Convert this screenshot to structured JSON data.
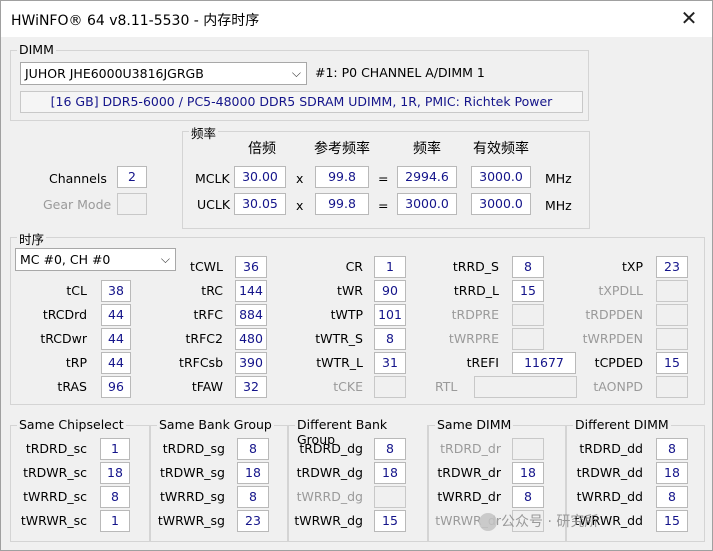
{
  "window": {
    "title": "HWiNFO® 64 v8.11-5530 - 内存时序"
  },
  "dimm": {
    "group_label": "DIMM",
    "module_select": "JUHOR JHE6000U3816JGRGB",
    "slot_text": "#1: P0 CHANNEL A/DIMM 1",
    "info": "[16 GB] DDR5-6000 / PC5-48000 DDR5 SDRAM UDIMM, 1R, PMIC: Richtek Power"
  },
  "freq": {
    "group_label": "频率",
    "headers": {
      "multiplier": "倍频",
      "ref": "参考频率",
      "freq": "频率",
      "eff": "有效频率"
    },
    "mclk": {
      "label": "MCLK",
      "multiplier": "30.00",
      "ref": "99.8",
      "freq": "2994.6",
      "eff": "3000.0"
    },
    "uclk": {
      "label": "UCLK",
      "multiplier": "30.05",
      "ref": "99.8",
      "freq": "3000.0",
      "eff": "3000.0"
    },
    "times": "x",
    "equals": "=",
    "unit": "MHz"
  },
  "channels": {
    "label": "Channels",
    "value": "2",
    "gear_label": "Gear Mode",
    "gear_value": ""
  },
  "timings": {
    "group_label": "时序",
    "select": "MC #0, CH #0",
    "tCL": "38",
    "tRCDrd": "44",
    "tRCDwr": "44",
    "tRP": "44",
    "tRAS": "96",
    "tCWL": "36",
    "tRC": "144",
    "tRFC": "884",
    "tRFC2": "480",
    "tRFCsb": "390",
    "tFAW": "32",
    "CR": "1",
    "tWR": "90",
    "tWTP": "101",
    "tWTR_S": "8",
    "tWTR_L": "31",
    "tCKE": "",
    "tRRD_S": "8",
    "tRRD_L": "15",
    "tRDPRE": "",
    "tWRPRE": "",
    "tREFI": "11677",
    "RTL": "",
    "tXP": "23",
    "tXPDLL": "",
    "tRDPDEN": "",
    "tWRPDEN": "",
    "tCPDED": "15",
    "tAONPD": ""
  },
  "bottom": {
    "same_chipselect": {
      "label": "Same Chipselect",
      "rows": [
        {
          "name": "tRDRD_sc",
          "value": "1"
        },
        {
          "name": "tRDWR_sc",
          "value": "18"
        },
        {
          "name": "tWRRD_sc",
          "value": "8"
        },
        {
          "name": "tWRWR_sc",
          "value": "1"
        }
      ]
    },
    "same_bank_group": {
      "label": "Same Bank Group",
      "rows": [
        {
          "name": "tRDRD_sg",
          "value": "8"
        },
        {
          "name": "tRDWR_sg",
          "value": "18"
        },
        {
          "name": "tWRRD_sg",
          "value": "8"
        },
        {
          "name": "tWRWR_sg",
          "value": "23"
        }
      ]
    },
    "different_bank_group": {
      "label": "Different Bank Group",
      "rows": [
        {
          "name": "tRDRD_dg",
          "value": "8"
        },
        {
          "name": "tRDWR_dg",
          "value": "18"
        },
        {
          "name": "tWRRD_dg",
          "value": ""
        },
        {
          "name": "tWRWR_dg",
          "value": "15"
        }
      ]
    },
    "same_dimm": {
      "label": "Same DIMM",
      "rows": [
        {
          "name": "tRDRD_dr",
          "value": ""
        },
        {
          "name": "tRDWR_dr",
          "value": "18"
        },
        {
          "name": "tWRRD_dr",
          "value": "8"
        },
        {
          "name": "tWRWR_dr",
          "value": ""
        }
      ]
    },
    "different_dimm": {
      "label": "Different DIMM",
      "rows": [
        {
          "name": "tRDRD_dd",
          "value": "8"
        },
        {
          "name": "tRDWR_dd",
          "value": "18"
        },
        {
          "name": "tWRRD_dd",
          "value": "8"
        },
        {
          "name": "tWRWR_dd",
          "value": "15"
        }
      ]
    }
  },
  "watermark": {
    "text": "公众号 · 研究所"
  }
}
